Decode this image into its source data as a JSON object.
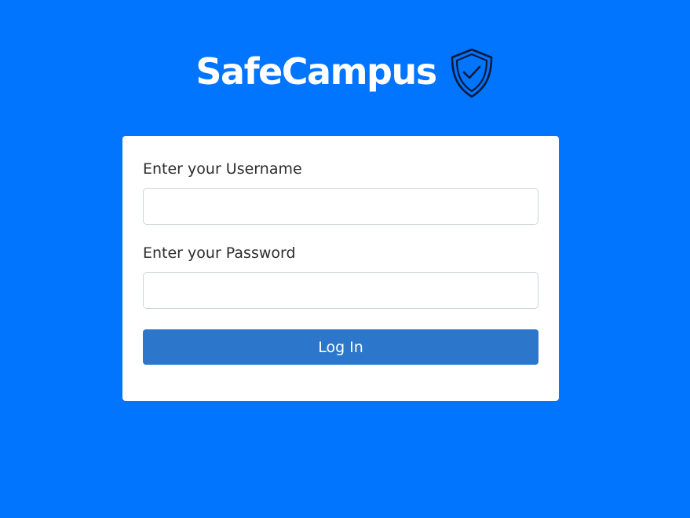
{
  "brand": {
    "title": "SafeCampus",
    "icon": "shield-check-icon"
  },
  "login_form": {
    "username_label": "Enter your Username",
    "username_value": "",
    "password_label": "Enter your Password",
    "password_value": "",
    "submit_label": "Log In"
  },
  "colors": {
    "background": "#0275ff",
    "card": "#ffffff",
    "button": "#2c77cc",
    "icon_stroke": "#0a1a3a"
  }
}
